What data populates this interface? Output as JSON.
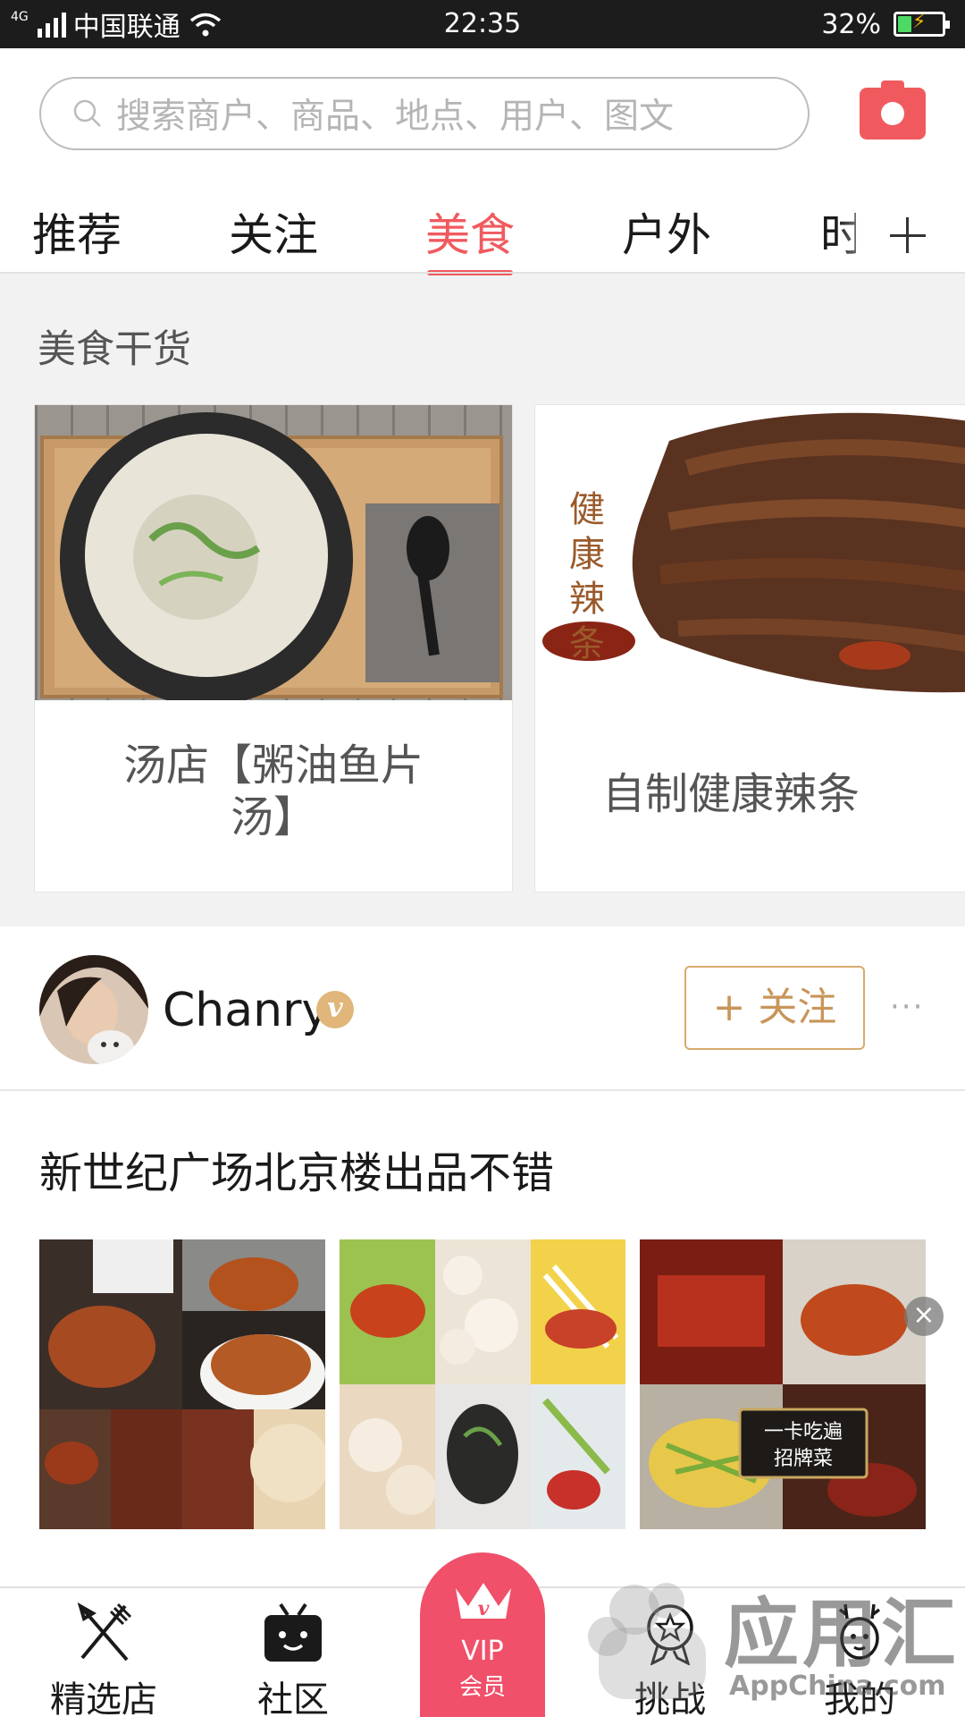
{
  "status_bar": {
    "network": "4G",
    "carrier": "中国联通",
    "time": "22:35",
    "battery": "32%",
    "battery_level": 0.32
  },
  "search": {
    "placeholder": "搜索商户、商品、地点、用户、图文"
  },
  "tabs": [
    {
      "label": "推荐",
      "active": false
    },
    {
      "label": "关注",
      "active": false
    },
    {
      "label": "美食",
      "active": true
    },
    {
      "label": "户外",
      "active": false
    },
    {
      "label": "时",
      "active": false
    }
  ],
  "section": {
    "title": "美食干货",
    "cards": [
      {
        "caption_line1": "汤店【粥油鱼片",
        "caption_line2": "汤】"
      },
      {
        "caption_line1": "自制健康辣条",
        "overlay_text": "健康辣条"
      }
    ]
  },
  "post": {
    "username": "Chanry",
    "verified_badge": "v",
    "follow_label": "+ 关注",
    "more": "···",
    "title": "新世纪广场北京楼出品不错",
    "photo3_overlay_line1": "一卡吃遍",
    "photo3_overlay_line2": "招牌菜"
  },
  "bottom_nav": {
    "items": [
      {
        "label": "精选店",
        "icon": "fork-knife-icon"
      },
      {
        "label": "社区",
        "icon": "tv-face-icon"
      },
      {
        "label": "挑战",
        "icon": "medal-icon"
      },
      {
        "label": "我的",
        "icon": "deer-icon"
      }
    ],
    "vip": {
      "label": "VIP",
      "sub": "会员",
      "icon": "crown-icon"
    }
  },
  "watermark": {
    "text": "应用汇",
    "sub": "AppChina.com"
  },
  "colors": {
    "accent": "#f05a5e",
    "vip": "#f0506a",
    "follow": "#c8965a",
    "badge": "#e0b67a"
  }
}
